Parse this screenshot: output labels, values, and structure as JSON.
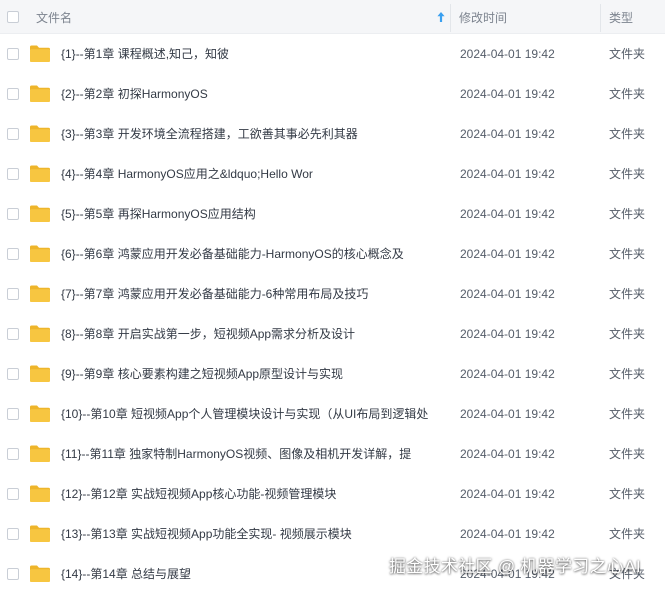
{
  "header": {
    "name_label": "文件名",
    "modified_label": "修改时间",
    "type_label": "类型",
    "sort_icon": "sort-ascending-arrow-icon"
  },
  "colors": {
    "folder": "#f7c641",
    "folder_tab": "#eeb52a",
    "sort_arrow": "#3aa0f0",
    "header_bg": "#f5f6f8"
  },
  "files": [
    {
      "name": "{1}--第1章 课程概述,知己，知彼",
      "modified": "2024-04-01 19:42",
      "type": "文件夹"
    },
    {
      "name": "{2}--第2章 初探HarmonyOS",
      "modified": "2024-04-01 19:42",
      "type": "文件夹"
    },
    {
      "name": "{3}--第3章 开发环境全流程搭建，工欲善其事必先利其器",
      "modified": "2024-04-01 19:42",
      "type": "文件夹"
    },
    {
      "name": "{4}--第4章 HarmonyOS应用之&ldquo;Hello Wor",
      "modified": "2024-04-01 19:42",
      "type": "文件夹"
    },
    {
      "name": "{5}--第5章 再探HarmonyOS应用结构",
      "modified": "2024-04-01 19:42",
      "type": "文件夹"
    },
    {
      "name": "{6}--第6章 鸿蒙应用开发必备基础能力-HarmonyOS的核心概念及",
      "modified": "2024-04-01 19:42",
      "type": "文件夹"
    },
    {
      "name": "{7}--第7章 鸿蒙应用开发必备基础能力-6种常用布局及技巧",
      "modified": "2024-04-01 19:42",
      "type": "文件夹"
    },
    {
      "name": "{8}--第8章 开启实战第一步，短视频App需求分析及设计",
      "modified": "2024-04-01 19:42",
      "type": "文件夹"
    },
    {
      "name": "{9}--第9章 核心要素构建之短视频App原型设计与实现",
      "modified": "2024-04-01 19:42",
      "type": "文件夹"
    },
    {
      "name": "{10}--第10章 短视频App个人管理模块设计与实现（从UI布局到逻辑处",
      "modified": "2024-04-01 19:42",
      "type": "文件夹"
    },
    {
      "name": "{11}--第11章 独家特制HarmonyOS视频、图像及相机开发详解，提",
      "modified": "2024-04-01 19:42",
      "type": "文件夹"
    },
    {
      "name": "{12}--第12章 实战短视频App核心功能-视频管理模块",
      "modified": "2024-04-01 19:42",
      "type": "文件夹"
    },
    {
      "name": "{13}--第13章 实战短视频App功能全实现- 视频展示模块",
      "modified": "2024-04-01 19:42",
      "type": "文件夹"
    },
    {
      "name": "{14}--第14章 总结与展望",
      "modified": "2024-04-01 19:42",
      "type": "文件夹"
    }
  ],
  "watermark": "掘金技术社区 @ 机器学习之心AI"
}
